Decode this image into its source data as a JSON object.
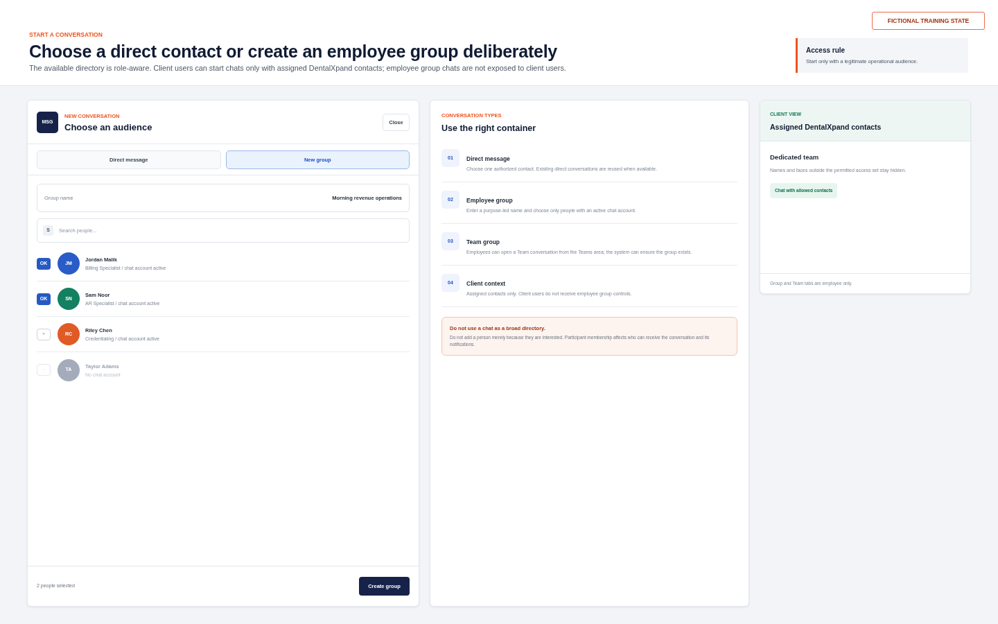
{
  "badge": "FICTIONAL TRAINING STATE",
  "header": {
    "eyebrow": "START A CONVERSATION",
    "title": "Choose a direct contact or create an employee group deliberately",
    "subtitle": "The available directory is role-aware. Client users can start chats only with assigned DentalXpand contacts; employee group chats are not exposed to client users.",
    "access_rule": {
      "title": "Access rule",
      "text": "Start only with a legitimate operational audience."
    }
  },
  "composer": {
    "logo": "MSG",
    "eyebrow": "NEW CONVERSATION",
    "title": "Choose an audience",
    "close": "Close",
    "tabs": [
      {
        "label": "Direct message",
        "selected": false
      },
      {
        "label": "New group",
        "selected": true
      }
    ],
    "group_name": {
      "label": "Group name",
      "value": "Morning revenue operations"
    },
    "search": {
      "key": "S",
      "placeholder": "Search people..."
    },
    "people": [
      {
        "mark": "OK",
        "checked": true,
        "disabled": false,
        "initials": "JM",
        "color": "#2a5cc7",
        "name": "Jordan Malik",
        "detail": "Billing Specialist / chat account active"
      },
      {
        "mark": "OK",
        "checked": true,
        "disabled": false,
        "initials": "SN",
        "color": "#138061",
        "name": "Sam Noor",
        "detail": "AR Specialist / chat account active"
      },
      {
        "mark": "+",
        "checked": false,
        "disabled": false,
        "initials": "RC",
        "color": "#e05a26",
        "name": "Riley Chen",
        "detail": "Credentialing / chat account active"
      },
      {
        "mark": "-",
        "checked": false,
        "disabled": true,
        "initials": "TA",
        "color": "#a4abba",
        "name": "Taylor Adams",
        "detail": "No chat account"
      }
    ],
    "footer": {
      "count": "2 people selected",
      "button": "Create group"
    }
  },
  "types": {
    "eyebrow": "CONVERSATION TYPES",
    "title": "Use the right container",
    "items": [
      {
        "number": "01",
        "title": "Direct message",
        "text": "Choose one authorized contact. Existing direct conversations are reused when available."
      },
      {
        "number": "02",
        "title": "Employee group",
        "text": "Enter a purpose-led name and choose only people with an active chat account."
      },
      {
        "number": "03",
        "title": "Team group",
        "text": "Employees can open a Team conversation from the Teams area; the system can ensure the group exists."
      },
      {
        "number": "04",
        "title": "Client context",
        "text": "Assigned contacts only. Client users do not receive employee group controls."
      }
    ],
    "warning": {
      "title": "Do not use a chat as a broad directory.",
      "text": "Do not add a person merely because they are interested. Participant membership affects who can receive the conversation and its notifications."
    }
  },
  "client_view": {
    "eyebrow": "CLIENT VIEW",
    "title": "Assigned DentalXpand contacts",
    "section_title": "Dedicated team",
    "text": "Names and faces outside the permitted access set stay hidden.",
    "action": "Chat with allowed contacts",
    "footer": "Group and Team tabs are employee only."
  }
}
